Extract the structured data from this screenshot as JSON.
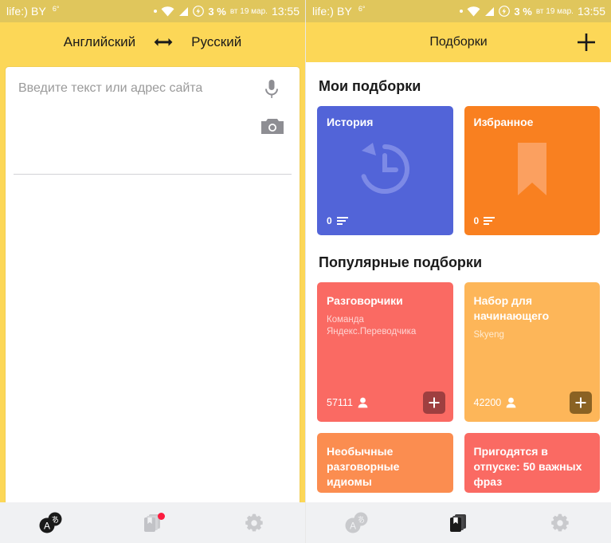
{
  "status_bar": {
    "carrier": "life:) BY",
    "temperature": "6°",
    "battery_percent": "3 %",
    "date": "вт 19 мар.",
    "time": "13:55",
    "icons": [
      "dot-icon",
      "wifi-icon",
      "signal-icon",
      "battery-charging-icon"
    ]
  },
  "left_screen": {
    "appbar": {
      "source_language": "Английский",
      "swap_icon": "swap-horizontal-icon",
      "target_language": "Русский"
    },
    "input": {
      "placeholder": "Введите текст или адрес сайта",
      "value": "",
      "mic_icon": "microphone-icon",
      "camera_icon": "camera-icon"
    },
    "bottom_nav": [
      {
        "name": "translate",
        "icon": "translate-icon",
        "active": true,
        "badge": false
      },
      {
        "name": "collections",
        "icon": "collections-cards-icon",
        "active": false,
        "badge": true
      },
      {
        "name": "settings",
        "icon": "gear-icon",
        "active": false,
        "badge": false
      }
    ]
  },
  "right_screen": {
    "appbar": {
      "title": "Подборки",
      "add_icon": "plus-icon"
    },
    "my_collections": {
      "section_title": "Мои подборки",
      "cards": [
        {
          "title": "История",
          "count": "0",
          "count_icon": "list-lines-icon",
          "art_icon": "history-clock-icon",
          "color": "#5264d8"
        },
        {
          "title": "Избранное",
          "count": "0",
          "count_icon": "list-lines-icon",
          "art_icon": "bookmark-icon",
          "color": "#f98020"
        }
      ]
    },
    "popular_collections": {
      "section_title": "Популярные подборки",
      "cards": [
        {
          "title": "Разговорчики",
          "author": "Команда Яндекс.Переводчика",
          "subscribers": "57111",
          "subscriber_icon": "person-icon",
          "add_icon": "plus-icon",
          "color": "#fa6a63",
          "chip_color": "#9e3f40"
        },
        {
          "title": "Набор для начинающего",
          "author": "Skyeng",
          "subscribers": "42200",
          "subscriber_icon": "person-icon",
          "add_icon": "plus-icon",
          "color": "#fdb659",
          "chip_color": "#8a6223"
        },
        {
          "title": "Необычные разговорные идиомы",
          "author": "",
          "subscribers": "",
          "color": "#fb8d50"
        },
        {
          "title": "Пригодятся в отпуске: 50 важных фраз",
          "author": "",
          "subscribers": "",
          "color": "#fa6a63"
        }
      ]
    },
    "bottom_nav": [
      {
        "name": "translate",
        "icon": "translate-icon",
        "active": false,
        "badge": false
      },
      {
        "name": "collections",
        "icon": "collections-cards-icon",
        "active": true,
        "badge": false
      },
      {
        "name": "settings",
        "icon": "gear-icon",
        "active": false,
        "badge": false
      }
    ]
  },
  "colors": {
    "header_yellow": "#fcd757",
    "status_yellow": "#e0c65c",
    "nav_background": "#f0f1f3",
    "badge_red": "#fc1c3f"
  }
}
